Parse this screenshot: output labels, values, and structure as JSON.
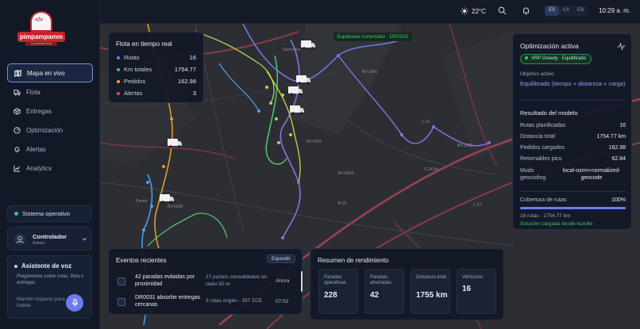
{
  "brand": {
    "name": "pimpampamm",
    "tagline": "by EUROPA FOOD"
  },
  "nav": [
    {
      "label": "Mapa en vivo",
      "icon": "map-icon",
      "active": true
    },
    {
      "label": "Flota",
      "icon": "truck-icon"
    },
    {
      "label": "Entregas",
      "icon": "box-icon"
    },
    {
      "label": "Optimización",
      "icon": "gauge-icon"
    },
    {
      "label": "Alertas",
      "icon": "bell-icon"
    },
    {
      "label": "Analytics",
      "icon": "chart-icon"
    }
  ],
  "system_status": "Sistema operativo",
  "user": {
    "name": "Controlador",
    "role": "Admin"
  },
  "voice": {
    "title": "Asistente de voz",
    "description": "Pregúntame sobre rutas, flota o entregas",
    "hint": "Mantén espacio para hablar"
  },
  "topbar": {
    "temperature": "22°C",
    "languages": [
      "ES",
      "CA",
      "EN"
    ],
    "selected_language": "ES",
    "time": "10:29 a. m."
  },
  "fleet": {
    "title": "Flota en tiempo real",
    "rows": [
      {
        "label": "Rutas",
        "value": "16",
        "color": "#6b7cf0"
      },
      {
        "label": "Km totales",
        "value": "1754.77",
        "color": "#3cc46b"
      },
      {
        "label": "Pedidos",
        "value": "162.98",
        "color": "#f0a830"
      },
      {
        "label": "Alertas",
        "value": "3",
        "color": "#e0474c"
      }
    ]
  },
  "supabase": "Supabase conectado · DR0031",
  "optimization": {
    "title": "Optimización activa",
    "badge": "VRP Greedy · Equilibrado",
    "objective_label": "Objetivo activo",
    "objective_value": "Equilibrado (tiempo + distancia + carga)",
    "result_title": "Resultado del modelo",
    "results": [
      {
        "label": "Rutas planificadas",
        "value": "16"
      },
      {
        "label": "Distancia total",
        "value": "1754.77 km"
      },
      {
        "label": "Pedidos cargados",
        "value": "162.98"
      },
      {
        "label": "Retornables pico",
        "value": "62.84"
      }
    ],
    "geocoding_label": "Modo geocoding",
    "geocoding_value": "local-osrm+normalized-geocode",
    "coverage_label": "Cobertura de rutas",
    "coverage_value": "100%",
    "coverage_fraction": 1.0,
    "coverage_detail": "16 rutas · 1754.77 km",
    "bundle_note": "Solución cargada desde bundle"
  },
  "events": {
    "title": "Eventos recientes",
    "expand_label": "Expandir",
    "items": [
      {
        "title": "42 paradas evitadas por proximidad",
        "description": "27 puntos consolidados en radio 50 m",
        "time": "Ahora"
      },
      {
        "title": "DR0031 absorbe entregas cercanas",
        "description": "3 rutas origen · 337 ZCE",
        "time": "07:02"
      }
    ]
  },
  "performance": {
    "title": "Resumen de rendimiento",
    "tiles": [
      {
        "label": "Paradas operativas",
        "value": "228"
      },
      {
        "label": "Paradas ahorradas",
        "value": "42"
      },
      {
        "label": "Distancia total",
        "value": "1755 km"
      },
      {
        "label": "Vehículos",
        "value": "16"
      }
    ]
  },
  "map_labels": [
    "Dunoelles",
    "BV-1601",
    "BV-5001",
    "BV-5003",
    "C-31",
    "BV-1602",
    "C-1415c",
    "B-20",
    "C-17",
    "BV-5008",
    "Parets"
  ],
  "colors": {
    "accent": "#6b7cf0",
    "success": "#3cc46b",
    "warning": "#f0a830",
    "danger": "#e0474c",
    "brand_red": "#c8232c"
  }
}
